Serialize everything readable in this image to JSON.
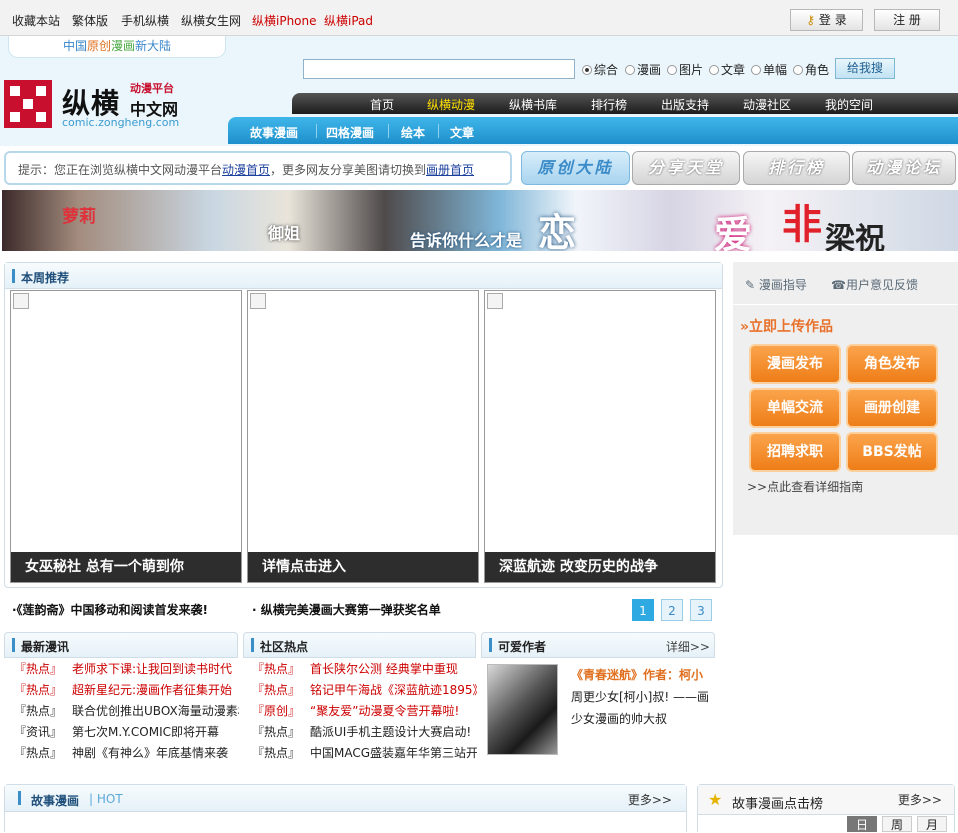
{
  "topbar": {
    "links": [
      "收藏本站",
      "繁体版",
      "手机纵横",
      "纵横女生网",
      "纵横iPhone",
      "纵横iPad"
    ],
    "login_label": "登 录",
    "register_label": "注 册"
  },
  "header": {
    "slogan": "中国原创漫画新大陆",
    "logo": {
      "title": "纵横",
      "sub1": "动漫平台",
      "sub2": "中文网",
      "url": "comic.zongheng.com"
    },
    "search": {
      "options": [
        "综合",
        "漫画",
        "图片",
        "文章",
        "单幅",
        "角色"
      ],
      "selected": "综合",
      "button": "给我搜"
    },
    "nav": [
      "首页",
      "纵横动漫",
      "纵横书库",
      "排行榜",
      "出版支持",
      "动漫社区",
      "我的空间"
    ],
    "nav_current": "纵横动漫",
    "subnav": [
      "故事漫画",
      "四格漫画",
      "绘本",
      "文章"
    ]
  },
  "tip": {
    "prefix": "提示：您正在浏览纵横中文网动漫平台",
    "link1": "动漫首页",
    "middle": "，更多网友分享美图请切换到",
    "link2": "画册首页"
  },
  "pills": [
    "原创大陆",
    "分享天堂",
    "排行榜",
    "动漫论坛"
  ],
  "banner": {
    "t1": "萝莉",
    "t2": "御姐",
    "t3": "告诉你什么才是",
    "t4": "恋",
    "t5": "爱",
    "t6": "非",
    "t7": "梁祝"
  },
  "weekly": {
    "title": "本周推荐",
    "cards": [
      "女巫秘社 总有一个萌到你",
      "详情点击进入",
      "深蓝航迹 改变历史的战争"
    ],
    "headlines": [
      "·《莲韵斋》中国移动和阅读首发来袭!",
      "· 纵横完美漫画大赛第一弹获奖名单"
    ],
    "pages": [
      "1",
      "2",
      "3"
    ],
    "current_page": "1"
  },
  "sidebar": {
    "guide": "漫画指导",
    "feedback": "用户意见反馈",
    "upload_title": "»立即上传作品",
    "buttons": [
      "漫画发布",
      "角色发布",
      "单幅交流",
      "画册创建",
      "招聘求职",
      "BBS发帖"
    ],
    "detail_link": ">>点此查看详细指南"
  },
  "news": {
    "title": "最新漫讯",
    "items": [
      {
        "tag": "『热点』",
        "text": "老师求下课:让我回到读书时代",
        "hot": true
      },
      {
        "tag": "『热点』",
        "text": "超新星纪元:漫画作者征集开始",
        "hot": true
      },
      {
        "tag": "『热点』",
        "text": "联合优创推出UBOX海量动漫素材",
        "hot": false
      },
      {
        "tag": "『资讯』",
        "text": "第七次M.Y.COMIC即将开幕",
        "hot": false
      },
      {
        "tag": "『热点』",
        "text": "神剧《有神么》年底基情来袭",
        "hot": false
      }
    ]
  },
  "community": {
    "title": "社区热点",
    "items": [
      {
        "tag": "『热点』",
        "text": "首长陕尔公测 经典掌中重现",
        "hot": true
      },
      {
        "tag": "『热点』",
        "text": "铭记甲午海战《深蓝航迹1895》",
        "hot": true
      },
      {
        "tag": "『原创』",
        "text": "“聚友爱”动漫夏令营开幕啦!",
        "hot": true
      },
      {
        "tag": "『热点』",
        "text": "酷派UI手机主题设计大赛启动!",
        "hot": false
      },
      {
        "tag": "『热点』",
        "text": "中国MACG盛装嘉年华第三站开启",
        "hot": false
      }
    ]
  },
  "author": {
    "title": "可爱作者",
    "more": "详细>>",
    "work": "《青春迷航》作者：柯小",
    "desc1": "周更少女[柯小]叔! ——画",
    "desc2": "少女漫画的帅大叔"
  },
  "story": {
    "title": "故事漫画",
    "sub": "| HOT",
    "more": "更多>>"
  },
  "rank": {
    "title": "故事漫画点击榜",
    "more": "更多>>",
    "tabs": [
      "日",
      "周",
      "月"
    ]
  }
}
